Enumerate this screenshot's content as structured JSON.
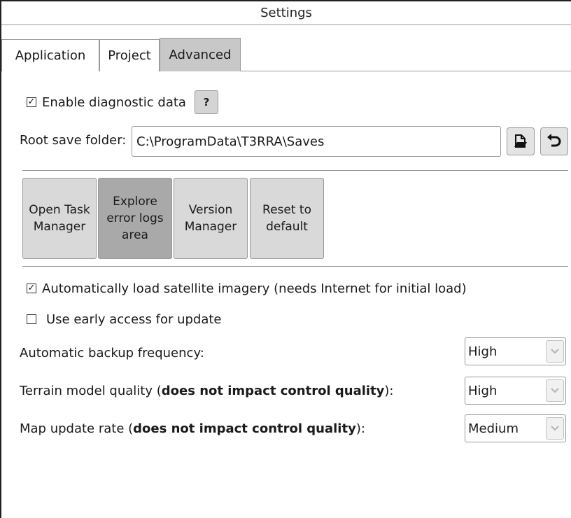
{
  "window": {
    "title": "Settings"
  },
  "tabs": [
    {
      "label": "Application",
      "active": false
    },
    {
      "label": "Project",
      "active": false
    },
    {
      "label": "Advanced",
      "active": true
    }
  ],
  "diagnostics": {
    "label": "Enable diagnostic data",
    "checked": true,
    "help_label": "?"
  },
  "root_folder": {
    "label": "Root save folder:",
    "value": "C:\\ProgramData\\T3RRA\\Saves"
  },
  "icons": {
    "browse": "file-open-icon",
    "reset": "undo-icon",
    "dropdown": "chevron-down-icon"
  },
  "actions": [
    {
      "label": "Open Task\nManager",
      "pressed": false
    },
    {
      "label": "Explore\nerror logs\narea",
      "pressed": true
    },
    {
      "label": "Version\nManager",
      "pressed": false
    },
    {
      "label": "Reset to\ndefault",
      "pressed": false
    }
  ],
  "options": {
    "satellite": {
      "label": "Automatically load satellite imagery (needs Internet for initial load)",
      "checked": true
    },
    "early_access": {
      "label": "Use early access for update",
      "checked": false
    }
  },
  "settings": {
    "backup": {
      "label": "Automatic backup frequency:",
      "value": "High"
    },
    "terrain": {
      "label_pre": "Terrain model quality (",
      "label_bold": "does not impact control quality",
      "label_post": "):",
      "value": "High"
    },
    "map_rate": {
      "label_pre": "Map update rate (",
      "label_bold": "does not impact control quality",
      "label_post": "):",
      "value": "Medium"
    }
  },
  "colors": {
    "tab_active": "#c8c8c8",
    "button": "#d9d9d9",
    "button_pressed": "#a9a9a9",
    "border": "#9a9a9a"
  }
}
